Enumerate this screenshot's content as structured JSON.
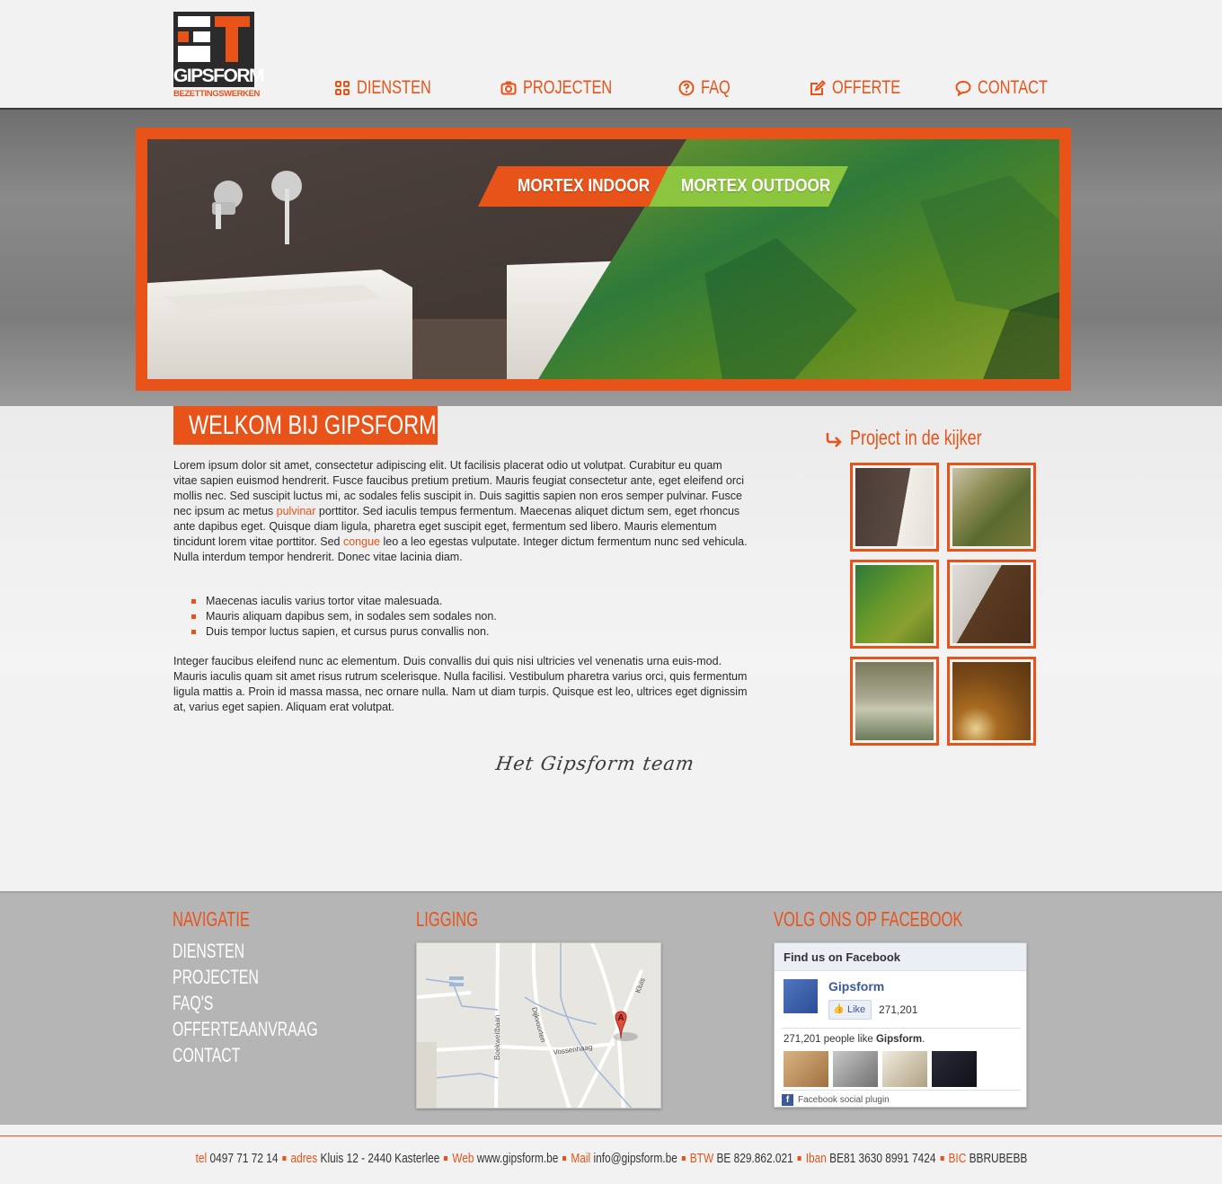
{
  "logo": {
    "name": "GIPSFORM",
    "subtitle": "BEZETTINGSWERKEN"
  },
  "nav": [
    {
      "label": "DIENSTEN",
      "icon": "grid-icon"
    },
    {
      "label": "PROJECTEN",
      "icon": "camera-icon"
    },
    {
      "label": "FAQ",
      "icon": "question-icon"
    },
    {
      "label": "OFFERTE",
      "icon": "edit-icon"
    },
    {
      "label": "CONTACT",
      "icon": "chat-bubble-icon"
    }
  ],
  "hero": {
    "tab_indoor": "MORTEX INDOOR",
    "tab_outdoor": "MORTEX OUTDOOR"
  },
  "main": {
    "title": "WELKOM BIJ GIPSFORM",
    "intro_a": "Lorem ipsum dolor sit amet, consectetur adipiscing elit. Ut facilisis placerat odio ut volutpat. Curabitur eu quam vitae sapien euismod hendrerit. Fusce faucibus pretium pretium. Mauris feugiat consectetur ante, eget eleifend orci mollis nec. Sed suscipit luctus mi, ac sodales felis suscipit in. Duis sagittis sapien non eros semper pulvinar. Fusce nec ipsum ac metus ",
    "link1": "pulvinar",
    "intro_b": " porttitor. Sed iaculis tempus fermentum. Maecenas aliquet dictum sem, eget rhoncus ante dapibus eget. Quisque diam ligula, pharetra eget suscipit eget, fermentum sed libero. Mauris elementum tincidunt lorem vitae porttitor. Sed ",
    "link2": "congue",
    "intro_c": " leo a leo egestas vulputate. Integer dictum fermentum nunc sed vehicula. Nulla interdum tempor hendrerit. Donec vitae lacinia diam.",
    "bullets": [
      "Maecenas iaculis varius tortor vitae malesuada.",
      "Mauris aliquam dapibus sem, in sodales sem sodales non.",
      "Duis tempor luctus sapien, et cursus purus convallis non."
    ],
    "outro": "Integer faucibus eleifend nunc ac elementum. Duis convallis dui quis nisi ultricies vel venenatis urna euis-mod. Mauris iaculis quam sit amet risus rutrum scelerisque. Nulla facilisi. Vestibulum pharetra varius orci, quis fermentum ligula mattis a. Proin id massa massa, nec ornare nulla. Nam ut diam turpis. Quisque est leo, ultrices eget dignissim at, varius eget sapien. Aliquam erat volutpat.",
    "signature": "Het Gipsform team"
  },
  "projects": {
    "title": "Project in de kijker"
  },
  "footer": {
    "nav_title": "NAVIGATIE",
    "nav_items": [
      "DIENSTEN",
      "PROJECTEN",
      "FAQ'S",
      "OFFERTEAANVRAAG",
      "CONTACT"
    ],
    "map_title": "LIGGING",
    "map_labels": {
      "road1": "Boekweitbaan",
      "road2": "Dijkvoorten",
      "road3": "Vossenhaag",
      "road4": "Kluis",
      "marker": "A"
    },
    "fb_title": "VOLG ONS OP FACEBOOK",
    "fb": {
      "header": "Find us on Facebook",
      "page_name": "Gipsform",
      "like_label": "Like",
      "like_count": "271,201",
      "people_count": "271,201 people like ",
      "people_page": "Gipsform",
      "people_end": ".",
      "plugin": "Facebook social plugin"
    }
  },
  "contact": {
    "tel_k": "tel",
    "tel_v": "0497 71 72 14",
    "adres_k": "adres",
    "adres_v": "Kluis 12 - 2440 Kasterlee",
    "web_k": "Web",
    "web_v": "www.gipsform.be",
    "mail_k": "Mail",
    "mail_v": "info@gipsform.be",
    "btw_k": "BTW",
    "btw_v": "BE 829.862.021",
    "iban_k": "Iban",
    "iban_v": "BE81 3630 8991 7424",
    "bic_k": "BIC",
    "bic_v": "BBRUBEBB"
  },
  "colors": {
    "accent": "#e8531a",
    "green": "#8cc63f",
    "footer_bg": "#b5b5b5"
  }
}
